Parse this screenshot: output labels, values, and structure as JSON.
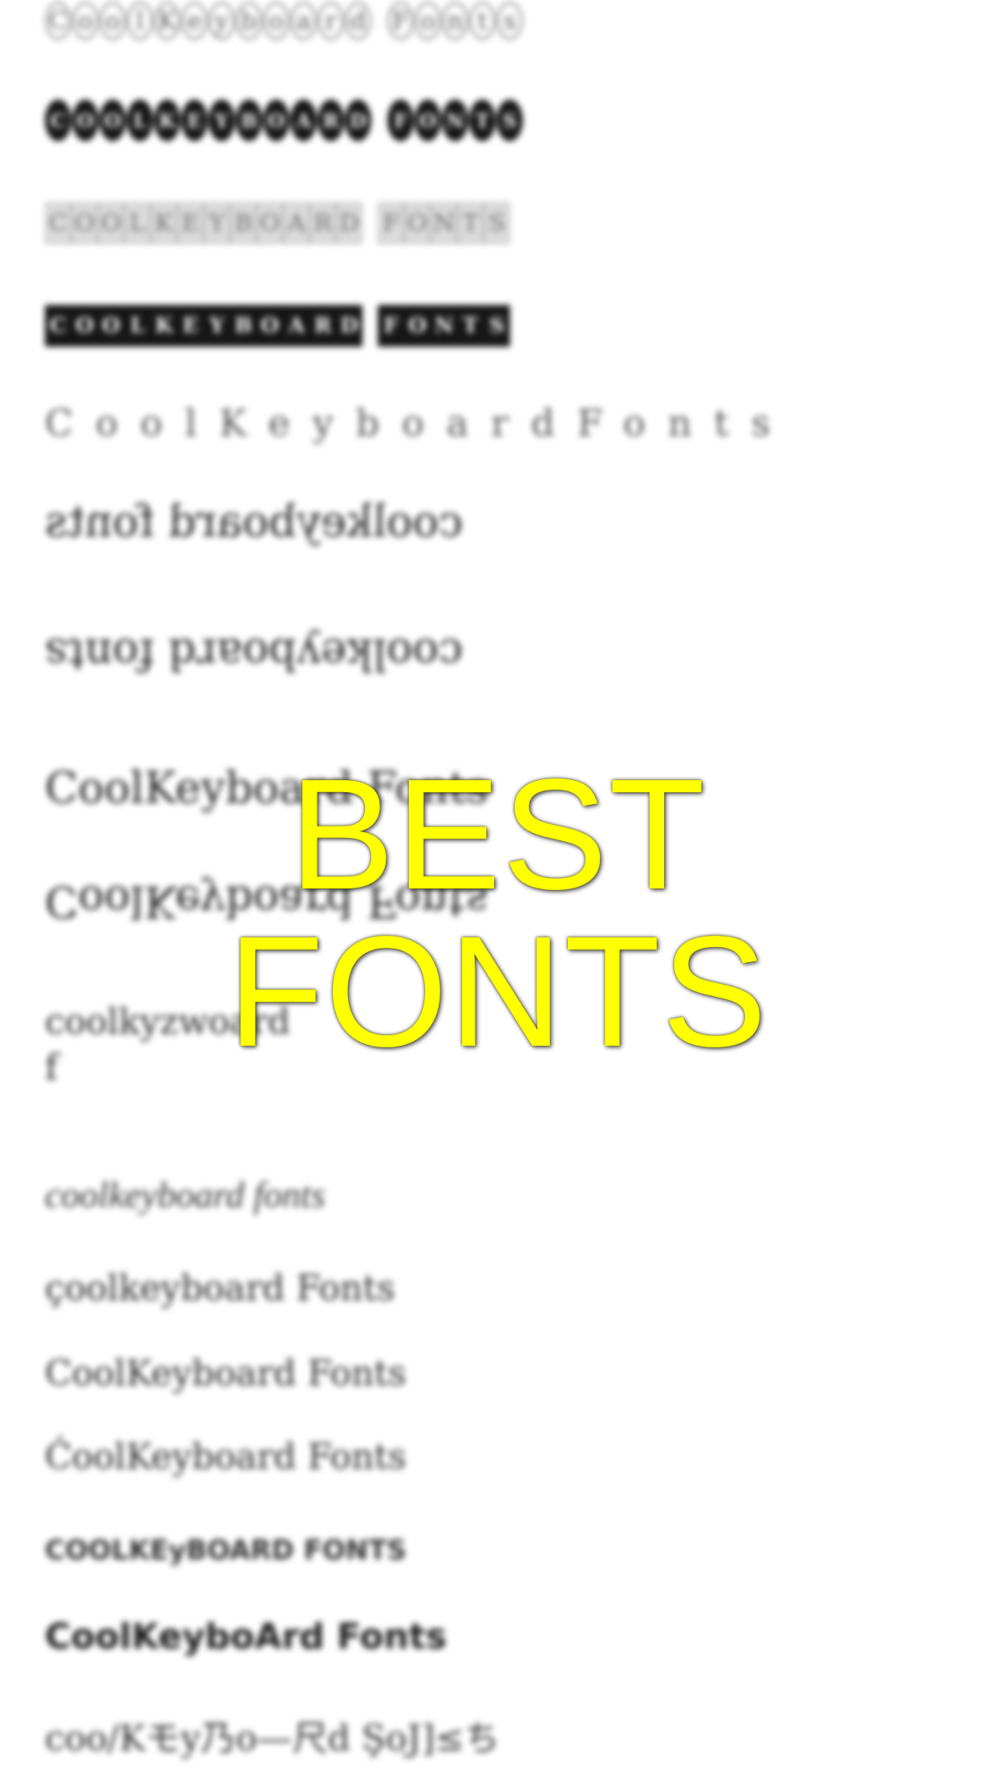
{
  "overlay": {
    "title": "BEST FONTS",
    "color": "#ffff00"
  },
  "fonts": {
    "circled": [
      "CoolKeyboard",
      "Fonts"
    ],
    "negative_circled": [
      "COOLKEYBOARD",
      "FONTS"
    ],
    "squared": [
      "COOLKEYBOARD",
      "FONTS"
    ],
    "negative_squared": [
      "COOLKEYBOARD",
      "FONTS"
    ],
    "spaced": "CoolKeyboardFonts",
    "mirrored": "coolkeyboard fonts",
    "upside_down": "coolkeyboard fonts",
    "partial_upper": "CoolKeyboard Fonts",
    "reversed_upside_down": "CoolKeyboard Fonts",
    "stylized_line1": "coolkyzwoard",
    "stylized_line2": "f",
    "italic": "coolkeyboard fonts",
    "symbol_mix": "çoolkeyboard Fonts",
    "accented_1": "CoolKeyboard Fonts",
    "accented_2": "ĆoolKeyboard Fonts",
    "small_caps": "COOLKEyBOARD FONTS",
    "bold_mix": "CoolKeyboArd Fonts",
    "cjk_style": "coo/Kモy乃o—尺d ŞoJ]≤ち"
  }
}
